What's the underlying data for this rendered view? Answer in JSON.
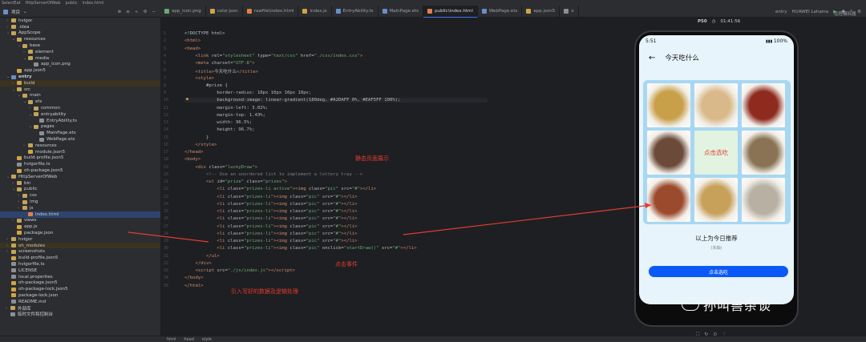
{
  "app": {
    "title": "SelectEat",
    "path": [
      "HttpServerOfWeb",
      "public",
      "index.html"
    ],
    "project_label": "项目"
  },
  "tabs": [
    {
      "label": "app_icon.png",
      "color": "#6aab73"
    },
    {
      "label": "color.json",
      "color": "#d0a444"
    },
    {
      "label": "rawfile\\index.html",
      "color": "#e0804a"
    },
    {
      "label": "index.js",
      "color": "#d0a444"
    },
    {
      "label": "EntryAbility.ts",
      "color": "#6a8fc8"
    },
    {
      "label": "MainPage.ets",
      "color": "#6a8fc8"
    },
    {
      "label": "public\\index.html",
      "color": "#e0804a",
      "active": true
    },
    {
      "label": "WebPage.ets",
      "color": "#6a8fc8"
    },
    {
      "label": "app.json5",
      "color": "#d0a444"
    },
    {
      "label": "o",
      "color": "#8c8f94"
    }
  ],
  "previewer_label": "远程模拟器",
  "device": {
    "module": "entry",
    "name": "HUAWEI Lahaina"
  },
  "tree": [
    {
      "depth": 0,
      "arrow": "›",
      "icon": "fold",
      "label": "hvigor"
    },
    {
      "depth": 0,
      "arrow": "›",
      "icon": "fold",
      "label": ".idea"
    },
    {
      "depth": 0,
      "arrow": "⌄",
      "icon": "fold",
      "label": "AppScope"
    },
    {
      "depth": 1,
      "arrow": "⌄",
      "icon": "fold",
      "label": "resources"
    },
    {
      "depth": 2,
      "arrow": "⌄",
      "icon": "fold",
      "label": "base"
    },
    {
      "depth": 3,
      "arrow": "›",
      "icon": "fold",
      "label": "element"
    },
    {
      "depth": 3,
      "arrow": "⌄",
      "icon": "fold",
      "label": "media"
    },
    {
      "depth": 4,
      "arrow": "",
      "icon": "file",
      "label": "app_icon.png"
    },
    {
      "depth": 1,
      "arrow": "",
      "icon": "file-y",
      "label": "app.json5"
    },
    {
      "depth": 0,
      "arrow": "⌄",
      "icon": "fold-blue",
      "label": "entry",
      "bold": true
    },
    {
      "depth": 1,
      "arrow": "›",
      "icon": "fold",
      "label": "build",
      "hl": true
    },
    {
      "depth": 1,
      "arrow": "⌄",
      "icon": "fold",
      "label": "src"
    },
    {
      "depth": 2,
      "arrow": "⌄",
      "icon": "fold",
      "label": "main"
    },
    {
      "depth": 3,
      "arrow": "⌄",
      "icon": "fold",
      "label": "ets"
    },
    {
      "depth": 4,
      "arrow": "›",
      "icon": "fold",
      "label": "common"
    },
    {
      "depth": 4,
      "arrow": "⌄",
      "icon": "fold",
      "label": "entryability"
    },
    {
      "depth": 5,
      "arrow": "",
      "icon": "file",
      "label": "EntryAbility.ts"
    },
    {
      "depth": 4,
      "arrow": "⌄",
      "icon": "fold",
      "label": "pages"
    },
    {
      "depth": 5,
      "arrow": "",
      "icon": "file",
      "label": "MainPage.ets"
    },
    {
      "depth": 5,
      "arrow": "",
      "icon": "file",
      "label": "WebPage.ets"
    },
    {
      "depth": 3,
      "arrow": "›",
      "icon": "fold",
      "label": "resources"
    },
    {
      "depth": 3,
      "arrow": "",
      "icon": "file-y",
      "label": "module.json5"
    },
    {
      "depth": 1,
      "arrow": "",
      "icon": "file-y",
      "label": "build-profile.json5"
    },
    {
      "depth": 1,
      "arrow": "",
      "icon": "file",
      "label": "hvigorfile.ts"
    },
    {
      "depth": 1,
      "arrow": "",
      "icon": "file-y",
      "label": "oh-package.json5"
    },
    {
      "depth": 0,
      "arrow": "⌄",
      "icon": "fold",
      "label": "HttpServerOfWeb"
    },
    {
      "depth": 1,
      "arrow": "›",
      "icon": "fold",
      "label": "bin"
    },
    {
      "depth": 1,
      "arrow": "⌄",
      "icon": "fold",
      "label": "public"
    },
    {
      "depth": 2,
      "arrow": "›",
      "icon": "fold",
      "label": "css"
    },
    {
      "depth": 2,
      "arrow": "›",
      "icon": "fold",
      "label": "img"
    },
    {
      "depth": 2,
      "arrow": "›",
      "icon": "fold",
      "label": "js"
    },
    {
      "depth": 3,
      "arrow": "",
      "icon": "file-o",
      "label": "index.html",
      "sel": true
    },
    {
      "depth": 1,
      "arrow": "›",
      "icon": "fold",
      "label": "views"
    },
    {
      "depth": 1,
      "arrow": "",
      "icon": "file-y",
      "label": "app.js"
    },
    {
      "depth": 1,
      "arrow": "",
      "icon": "file-y",
      "label": "package.json"
    },
    {
      "depth": 0,
      "arrow": "›",
      "icon": "fold",
      "label": "hvigor"
    },
    {
      "depth": 0,
      "arrow": "›",
      "icon": "fold",
      "label": "oh_modules",
      "hl": true
    },
    {
      "depth": 0,
      "arrow": "›",
      "icon": "fold",
      "label": "screenshots"
    },
    {
      "depth": 0,
      "arrow": "",
      "icon": "file-y",
      "label": "build-profile.json5"
    },
    {
      "depth": 0,
      "arrow": "",
      "icon": "file",
      "label": "hvigorfile.ts"
    },
    {
      "depth": 0,
      "arrow": "",
      "icon": "file",
      "label": "LICENSE"
    },
    {
      "depth": 0,
      "arrow": "",
      "icon": "file",
      "label": "local.properties"
    },
    {
      "depth": 0,
      "arrow": "",
      "icon": "file-y",
      "label": "oh-package.json5"
    },
    {
      "depth": 0,
      "arrow": "",
      "icon": "file-y",
      "label": "oh-package-lock.json5"
    },
    {
      "depth": 0,
      "arrow": "",
      "icon": "file-y",
      "label": "package-lock.json"
    },
    {
      "depth": 0,
      "arrow": "",
      "icon": "file",
      "label": "README.md"
    },
    {
      "depth": -1,
      "arrow": "›",
      "icon": "fold",
      "label": "外部库"
    },
    {
      "depth": -1,
      "arrow": "",
      "icon": "file",
      "label": "临时文件和控制台"
    }
  ],
  "code_lines": [
    {
      "n": "1",
      "html": "<span class='p'>&lt;!DOCTYPE html&gt;</span>"
    },
    {
      "n": "2",
      "html": "<span class='t'>&lt;html&gt;</span>"
    },
    {
      "n": "3",
      "html": "<span class='t'>&lt;head&gt;</span>"
    },
    {
      "n": "4",
      "html": "    <span class='t'>&lt;link</span> <span class='a'>rel=</span><span class='s'>\"stylesheet\"</span> <span class='a'>type=</span><span class='s'>\"text/css\"</span> <span class='a'>href=</span><span class='s'>\"./css/index.css\"</span><span class='t'>&gt;</span>"
    },
    {
      "n": "5",
      "html": "    <span class='t'>&lt;meta</span> <span class='a'>charset=</span><span class='s'>\"UTF-8\"</span><span class='t'>&gt;</span>"
    },
    {
      "n": "6",
      "html": "    <span class='t'>&lt;title&gt;</span><span class='p'>今天吃什么</span><span class='t'>&lt;/title&gt;</span>"
    },
    {
      "n": "7",
      "html": "    <span class='t'>&lt;style&gt;</span>"
    },
    {
      "n": "8",
      "html": "        <span class='p'>#prize {</span>"
    },
    {
      "n": "9",
      "html": "            <span class='a'>border-radius: 10px 10px 10px 10px;</span>"
    },
    {
      "n": "10",
      "html": "            <span class='a'>background-image: linear-gradient(180deg, #A2DAFF 0%, #EAF5FF 100%);</span>",
      "cur": true
    },
    {
      "n": "11",
      "html": "            <span class='a'>margin-left: 3.02%;</span>"
    },
    {
      "n": "12",
      "html": "            <span class='a'>margin-top: 1.43%;</span>"
    },
    {
      "n": "13",
      "html": "            <span class='a'>width: 96.5%;</span>"
    },
    {
      "n": "14",
      "html": "            <span class='a'>height: 96.7%;</span>"
    },
    {
      "n": "15",
      "html": "        <span class='p'>}</span>"
    },
    {
      "n": "16",
      "html": "    <span class='t'>&lt;/style&gt;</span>"
    },
    {
      "n": "17",
      "html": "<span class='t'>&lt;/head&gt;</span>"
    },
    {
      "n": "18",
      "html": "<span class='t'>&lt;body&gt;</span>"
    },
    {
      "n": "19",
      "html": "    <span class='t'>&lt;div</span> <span class='a'>class=</span><span class='s'>\"luckyDraw\"</span><span class='t'>&gt;</span>"
    },
    {
      "n": "20",
      "html": "        <span class='c'>&lt;!-- Use an unordered list to implement a lottery tray --&gt;</span>"
    },
    {
      "n": "21",
      "html": "        <span class='t'>&lt;ul</span> <span class='a'>id=</span><span class='s'>\"prize\"</span> <span class='a'>class=</span><span class='s'>\"prizes\"</span><span class='t'>&gt;</span>"
    },
    {
      "n": "22",
      "html": "            <span class='t'>&lt;li</span> <span class='a'>class=</span><span class='s'>\"prizes-li active\"</span><span class='t'>&gt;&lt;img</span> <span class='a'>class=</span><span class='s'>\"pic\"</span> <span class='a'>src=</span><span class='s'>\"#\"</span><span class='t'>&gt;&lt;/li&gt;</span>"
    },
    {
      "n": "23",
      "html": "            <span class='t'>&lt;li</span> <span class='a'>class=</span><span class='s'>\"prizes-li\"</span><span class='t'>&gt;&lt;img</span> <span class='a'>class=</span><span class='s'>\"pic\"</span> <span class='a'>src=</span><span class='s'>\"#\"</span><span class='t'>&gt;&lt;/li&gt;</span>"
    },
    {
      "n": "24",
      "html": "            <span class='t'>&lt;li</span> <span class='a'>class=</span><span class='s'>\"prizes-li\"</span><span class='t'>&gt;&lt;img</span> <span class='a'>class=</span><span class='s'>\"pic\"</span> <span class='a'>src=</span><span class='s'>\"#\"</span><span class='t'>&gt;&lt;/li&gt;</span>"
    },
    {
      "n": "25",
      "html": "            <span class='t'>&lt;li</span> <span class='a'>class=</span><span class='s'>\"prizes-li\"</span><span class='t'>&gt;&lt;img</span> <span class='a'>class=</span><span class='s'>\"pic\"</span> <span class='a'>src=</span><span class='s'>\"#\"</span><span class='t'>&gt;&lt;/li&gt;</span>"
    },
    {
      "n": "26",
      "html": "            <span class='t'>&lt;li</span> <span class='a'>class=</span><span class='s'>\"prizes-li\"</span><span class='t'>&gt;&lt;img</span> <span class='a'>class=</span><span class='s'>\"pic\"</span> <span class='a'>src=</span><span class='s'>\"#\"</span><span class='t'>&gt;&lt;/li&gt;</span>"
    },
    {
      "n": "27",
      "html": "            <span class='t'>&lt;li</span> <span class='a'>class=</span><span class='s'>\"prizes-li\"</span><span class='t'>&gt;&lt;img</span> <span class='a'>class=</span><span class='s'>\"pic\"</span> <span class='a'>src=</span><span class='s'>\"#\"</span><span class='t'>&gt;&lt;/li&gt;</span>"
    },
    {
      "n": "28",
      "html": "            <span class='t'>&lt;li</span> <span class='a'>class=</span><span class='s'>\"prizes-li\"</span><span class='t'>&gt;&lt;img</span> <span class='a'>class=</span><span class='s'>\"pic\"</span> <span class='a'>src=</span><span class='s'>\"#\"</span><span class='t'>&gt;&lt;/li&gt;</span>"
    },
    {
      "n": "29",
      "html": "            <span class='t'>&lt;li</span> <span class='a'>class=</span><span class='s'>\"prizes-li\"</span><span class='t'>&gt;&lt;img</span> <span class='a'>class=</span><span class='s'>\"pic\"</span> <span class='a'>src=</span><span class='s'>\"#\"</span><span class='t'>&gt;&lt;/li&gt;</span>"
    },
    {
      "n": "30",
      "html": "            <span class='t'>&lt;li</span> <span class='a'>class=</span><span class='s'>\"prizes-li\"</span><span class='t'>&gt;&lt;img</span> <span class='a'>class=</span><span class='s'>\"pic\"</span> <span class='a'>onclick=</span><span class='s'>\"startDraw()\"</span> <span class='a'>src=</span><span class='s'>\"#\"</span><span class='t'>&gt;&lt;/li&gt;</span>"
    },
    {
      "n": "31",
      "html": "        <span class='t'>&lt;/ul&gt;</span>"
    },
    {
      "n": "32",
      "html": "    <span class='t'>&lt;/div&gt;</span>"
    },
    {
      "n": "33",
      "html": "    <span class='t'>&lt;script</span> <span class='a'>src=</span><span class='s'>\"./js/index.js\"</span><span class='t'>&gt;&lt;/script&gt;</span>"
    },
    {
      "n": "34",
      "html": "<span class='t'>&lt;/body&gt;</span>"
    },
    {
      "n": "35",
      "html": "<span class='t'>&lt;/html&gt;</span>"
    }
  ],
  "annotations": {
    "static_page": "静态页面展示",
    "click_event": "点击事件",
    "data_logic": "引入写好的数据及逻辑处理"
  },
  "phone": {
    "time": "5:51",
    "battery": "100%",
    "device_label": "P50",
    "clock": "01:41:56",
    "title": "今天吃什么",
    "center_cell": "点击选吃",
    "result_title": "以上为今日推荐",
    "result_sub": "(未抽)",
    "button": "点击选吃"
  },
  "food_colors": [
    "#c9a04a",
    "#d9b98a",
    "#8e2a1e",
    "#6b4a3a",
    "#e2f3e2",
    "#8a7355",
    "#9b4a2e",
    "#c7a05a",
    "#b7b0a3"
  ],
  "watermark": "孙叫兽杂谈",
  "status": [
    "html",
    "head",
    "style"
  ]
}
